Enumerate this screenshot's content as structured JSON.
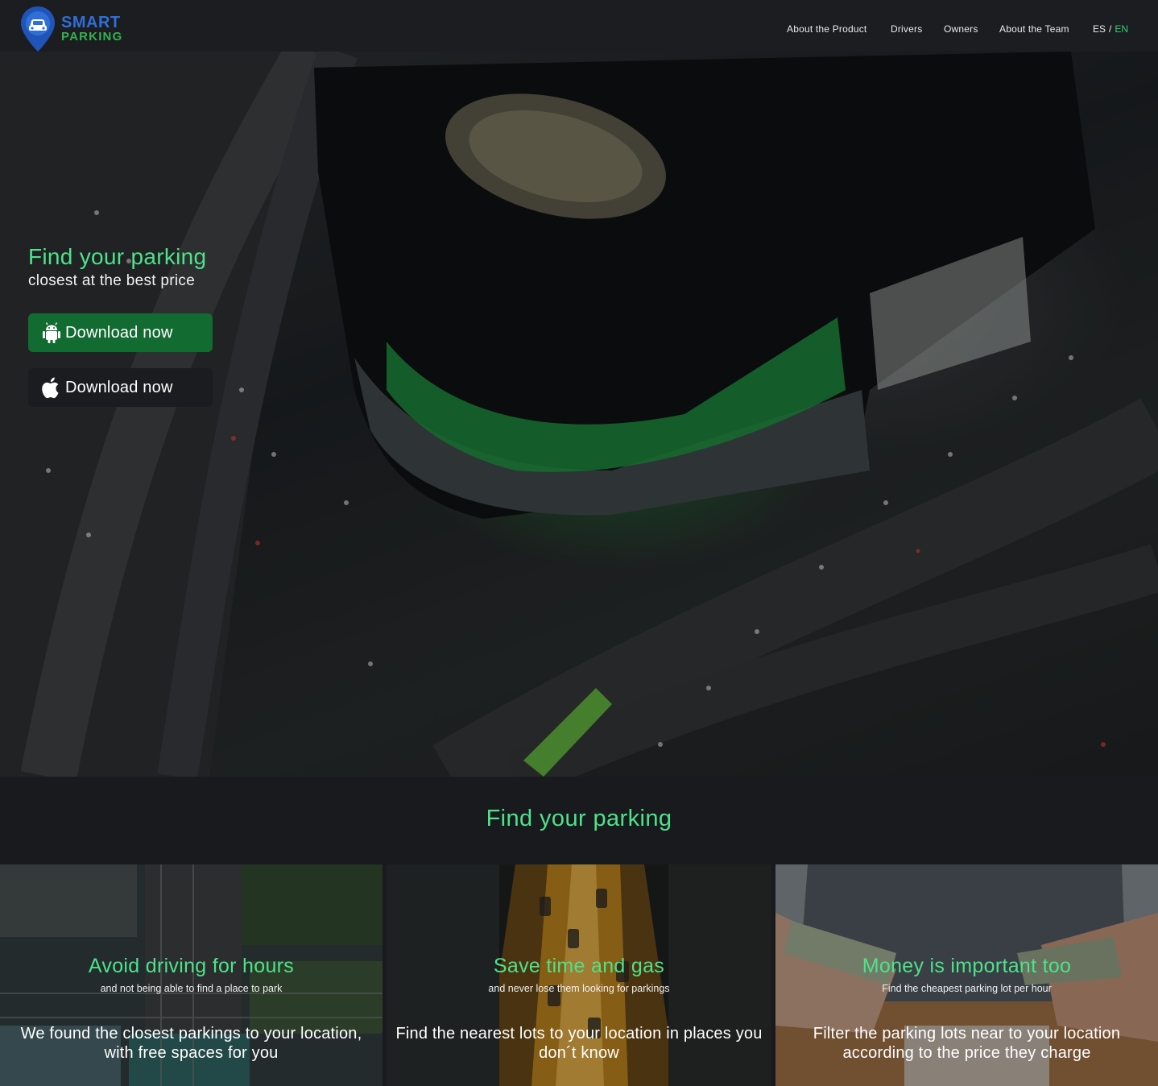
{
  "brand": {
    "line1": "SMART",
    "line2": "PARKING",
    "colors": {
      "blue": "#2f6fd6",
      "green": "#32b34f"
    }
  },
  "nav": {
    "items": [
      {
        "label": "About the Product"
      },
      {
        "label": "Drivers"
      },
      {
        "label": "Owners"
      },
      {
        "label": "About the Team"
      }
    ],
    "lang_es": "ES",
    "lang_sep": "/",
    "lang_en": "EN"
  },
  "hero": {
    "title": "Find your parking",
    "subtitle": "closest at the best price",
    "android_button": "Download now",
    "apple_button": "Download now",
    "icons": {
      "android": "android-icon",
      "apple": "apple-icon"
    }
  },
  "section": {
    "title": "Find your parking"
  },
  "cards": [
    {
      "title": "Avoid driving for hours",
      "subtitle": "and not being able to find a place to park",
      "body": "We found the closest parkings to your location, with free spaces for you"
    },
    {
      "title": "Save time and gas",
      "subtitle": "and never lose them looking for parkings",
      "body": "Find the nearest lots to your location in places you don´t know"
    },
    {
      "title": "Money is important too",
      "subtitle": "Find the cheapest parking lot per hour",
      "body": "Filter the parking lots near to your location according to the price they charge"
    }
  ],
  "theme": {
    "accent": "#4ee28a",
    "background": "#181a1e",
    "header": "#1b1d21",
    "android_button": "#126b31",
    "apple_button": "#1b1c1f"
  }
}
